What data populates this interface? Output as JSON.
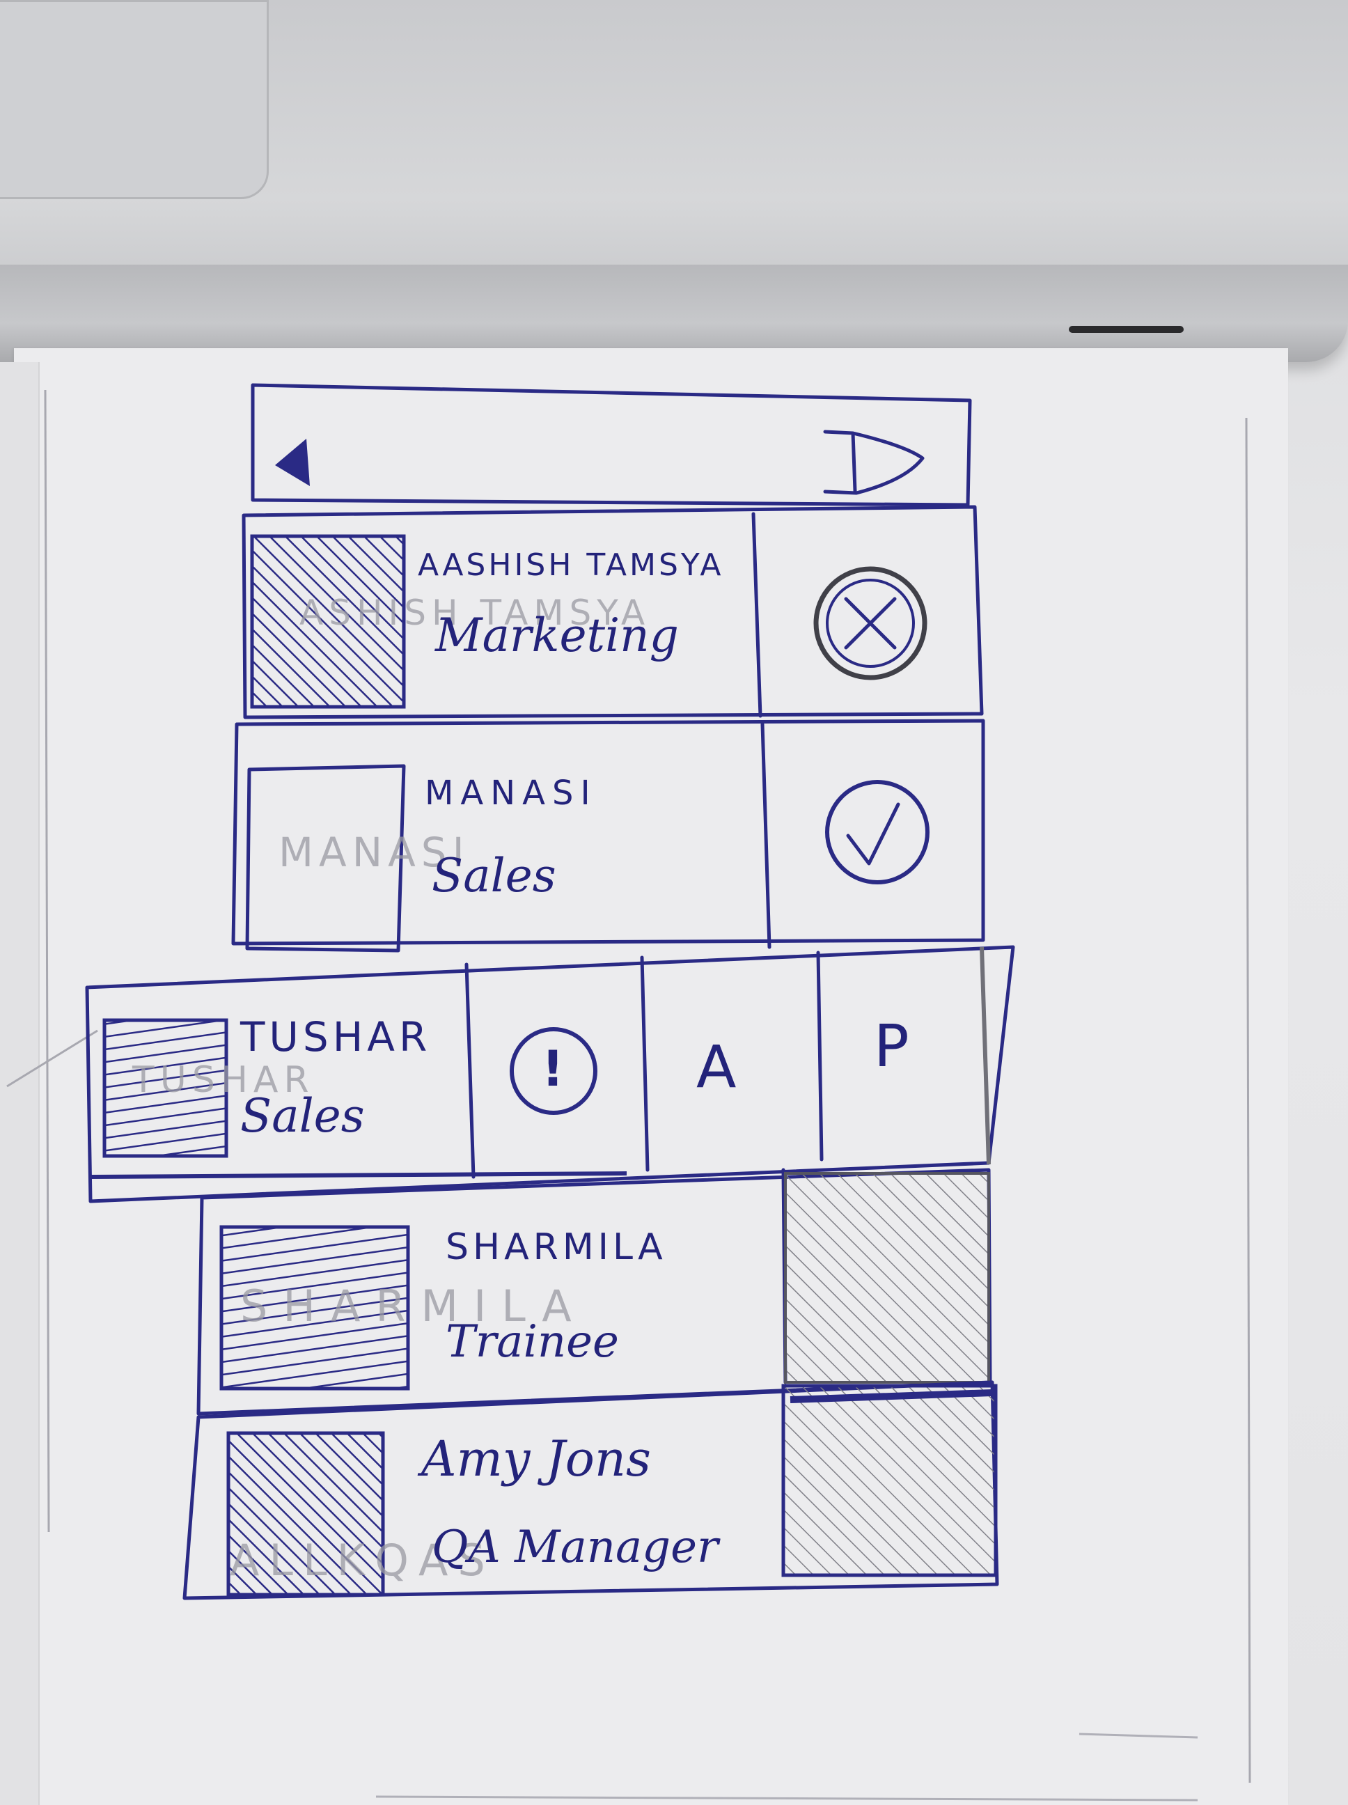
{
  "list": {
    "rows": [
      {
        "name": "AASHISH TAMSYA",
        "department": "Marketing",
        "status": "declined"
      },
      {
        "name": "MANASI",
        "department": "Sales",
        "status": "approved"
      },
      {
        "name": "TUSHAR",
        "department": "Sales",
        "status": "pending",
        "actions": [
          "!",
          "A",
          "P"
        ]
      },
      {
        "name": "SHARMILA",
        "department": "Trainee",
        "status": "none"
      },
      {
        "name": "Amy Jons",
        "department": "QA Manager",
        "status": "none"
      }
    ]
  },
  "sketch": {
    "pencil_notes": [
      "ASHISH TAMSYA",
      "MANASI",
      "TUSHAR",
      "SHARMILA",
      "ALLKQAS"
    ]
  },
  "colors": {
    "ink": "#2a2a85",
    "pencil": "#8f8f96",
    "paper": "#ececee",
    "laptop": "#c9cacd"
  }
}
